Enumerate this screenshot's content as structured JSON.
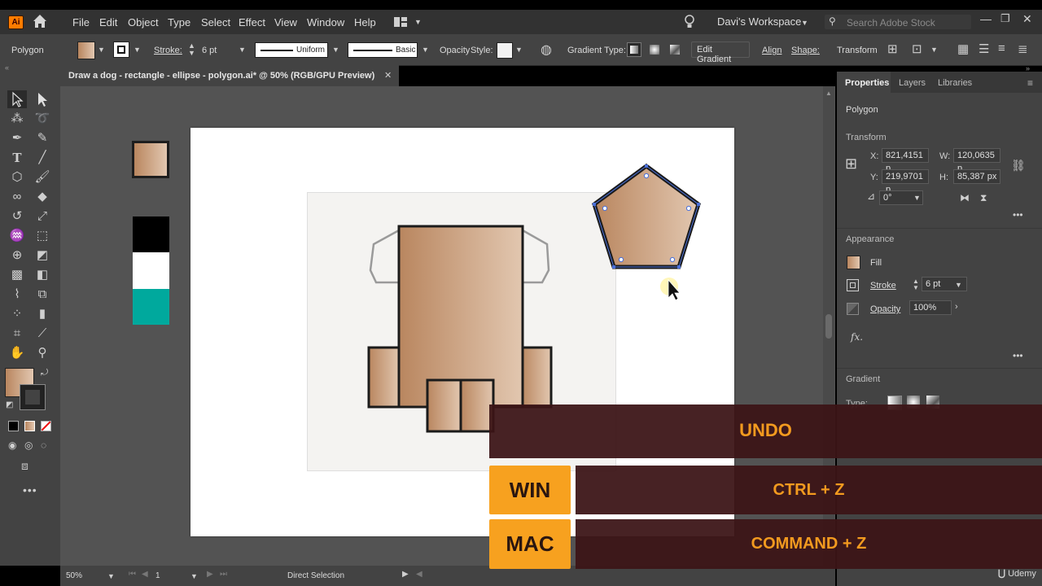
{
  "app": {
    "logo": "Ai",
    "menu": [
      "File",
      "Edit",
      "Object",
      "Type",
      "Select",
      "Effect",
      "View",
      "Window",
      "Help"
    ],
    "workspace": "Davi's Workspace",
    "search_placeholder": "Search Adobe Stock"
  },
  "control_bar": {
    "object_type": "Polygon",
    "stroke_label": "Stroke:",
    "stroke_value": "6 pt",
    "profile_label": "Uniform",
    "brush_label": "Basic",
    "opacity_label": "Opacity",
    "style_label": "Style:",
    "gradient_type_label": "Gradient Type:",
    "edit_gradient": "Edit Gradient",
    "align": "Align",
    "shape": "Shape:",
    "transform": "Transform"
  },
  "document": {
    "tab_title": "Draw a dog - rectangle - ellipse - polygon.ai* @ 50% (RGB/GPU Preview)"
  },
  "status_bar": {
    "zoom": "50%",
    "artboard_number": "1",
    "tool_name": "Direct Selection"
  },
  "properties_panel": {
    "tabs": [
      "Properties",
      "Layers",
      "Libraries"
    ],
    "object_type": "Polygon",
    "transform_title": "Transform",
    "x_label": "X:",
    "x_value": "821,4151 p",
    "y_label": "Y:",
    "y_value": "219,9701 p",
    "w_label": "W:",
    "w_value": "120,0635 p",
    "h_label": "H:",
    "h_value": "85,387 px",
    "rotation_value": "0°",
    "appearance_title": "Appearance",
    "fill_label": "Fill",
    "stroke_label": "Stroke",
    "stroke_value": "6 pt",
    "opacity_label": "Opacity",
    "opacity_value": "100%",
    "fx_label": "fx.",
    "gradient_title": "Gradient",
    "gradient_type_label": "Type:"
  },
  "overlay": {
    "action": "UNDO",
    "win_label": "WIN",
    "win_shortcut": "CTRL + Z",
    "mac_label": "MAC",
    "mac_shortcut": "COMMAND + Z",
    "watermark": "Udemy"
  },
  "colors": {
    "gradient_start": "#b9865f",
    "gradient_end": "#e2c7b0",
    "swatch_black": "#000000",
    "swatch_white": "#ffffff",
    "swatch_teal": "#00a99d",
    "overlay_accent": "#f7a11f",
    "selection_blue": "#4a6fd8"
  }
}
